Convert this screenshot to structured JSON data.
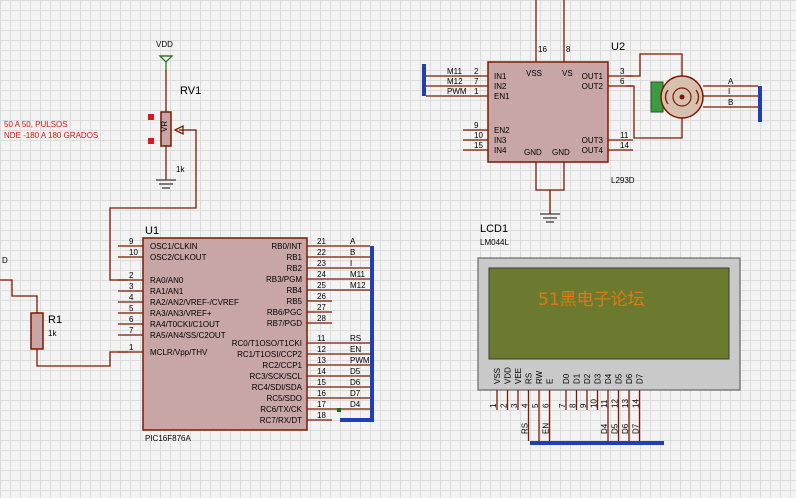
{
  "components": {
    "vdd_label": "VDD",
    "rv1": {
      "ref": "RV1",
      "value": "1k",
      "tag": "VR"
    },
    "note": {
      "line1": "50 A 50, PULSOS",
      "line2": "NDE -180 A 180 GRADOS"
    },
    "r1": {
      "ref": "R1",
      "value": "1k"
    },
    "vdd_clip": "D",
    "u1": {
      "ref": "U1",
      "part": "PIC16F876A",
      "left_pins": [
        {
          "num": "9",
          "name": "OSC1/CLKIN"
        },
        {
          "num": "10",
          "name": "OSC2/CLKOUT"
        },
        {
          "num": "2",
          "name": "RA0/AN0"
        },
        {
          "num": "3",
          "name": "RA1/AN1"
        },
        {
          "num": "4",
          "name": "RA2/AN2/VREF-/CVREF"
        },
        {
          "num": "5",
          "name": "RA3/AN3/VREF+"
        },
        {
          "num": "6",
          "name": "RA4/T0CKI/C1OUT"
        },
        {
          "num": "7",
          "name": "RA5/AN4/SS/C2OUT"
        },
        {
          "num": "1",
          "name": "MCLR/Vpp/THV"
        }
      ],
      "right_pins": [
        {
          "num": "21",
          "name": "RB0/INT",
          "net": "A"
        },
        {
          "num": "22",
          "name": "RB1",
          "net": "B"
        },
        {
          "num": "23",
          "name": "RB2",
          "net": "I"
        },
        {
          "num": "24",
          "name": "RB3/PGM",
          "net": "M11"
        },
        {
          "num": "25",
          "name": "RB4",
          "net": "M12"
        },
        {
          "num": "26",
          "name": "RB5",
          "net": ""
        },
        {
          "num": "27",
          "name": "RB6/PGC",
          "net": ""
        },
        {
          "num": "28",
          "name": "RB7/PGD",
          "net": ""
        },
        {
          "num": "11",
          "name": "RC0/T1OSO/T1CKI",
          "net": "RS"
        },
        {
          "num": "12",
          "name": "RC1/T1OSI/CCP2",
          "net": "EN"
        },
        {
          "num": "13",
          "name": "RC2/CCP1",
          "net": "PWM"
        },
        {
          "num": "14",
          "name": "RC3/SCK/SCL",
          "net": "D5"
        },
        {
          "num": "15",
          "name": "RC4/SDI/SDA",
          "net": "D6"
        },
        {
          "num": "16",
          "name": "RC5/SDO",
          "net": "D7"
        },
        {
          "num": "17",
          "name": "RC6/TX/CK",
          "net": "D4"
        },
        {
          "num": "18",
          "name": "RC7/RX/DT",
          "net": ""
        }
      ]
    },
    "u2": {
      "ref": "U2",
      "part": "L293D",
      "top_pins": [
        {
          "num": "16",
          "name": "VSS"
        },
        {
          "num": "8",
          "name": "VS"
        }
      ],
      "left_pins": [
        {
          "num": "2",
          "name": "IN1",
          "net": "M11"
        },
        {
          "num": "7",
          "name": "IN2",
          "net": "M12"
        },
        {
          "num": "1",
          "name": "EN1",
          "net": "PWM"
        },
        {
          "num": "9",
          "name": "EN2",
          "net": ""
        },
        {
          "num": "10",
          "name": "IN3",
          "net": ""
        },
        {
          "num": "15",
          "name": "IN4",
          "net": ""
        }
      ],
      "right_pins": [
        {
          "num": "3",
          "name": "OUT1"
        },
        {
          "num": "6",
          "name": "OUT2"
        },
        {
          "num": "11",
          "name": "OUT3"
        },
        {
          "num": "14",
          "name": "OUT4"
        }
      ],
      "bottom_pins": [
        {
          "name": "GND"
        },
        {
          "name": "GND"
        }
      ]
    },
    "motor": {
      "nets": [
        "A",
        "I",
        "B"
      ]
    },
    "lcd": {
      "ref": "LCD1",
      "part": "LM044L",
      "screen_text": "51黑电子论坛",
      "screen_color": "#e07a10",
      "pins": [
        {
          "num": "1",
          "name": "VSS"
        },
        {
          "num": "2",
          "name": "VDD"
        },
        {
          "num": "3",
          "name": "VEE"
        },
        {
          "num": "4",
          "name": "RS",
          "net": "RS"
        },
        {
          "num": "5",
          "name": "RW",
          "net": ""
        },
        {
          "num": "6",
          "name": "E",
          "net": "EN"
        },
        {
          "num": "7",
          "name": "D0"
        },
        {
          "num": "8",
          "name": "D1"
        },
        {
          "num": "9",
          "name": "D2"
        },
        {
          "num": "10",
          "name": "D3"
        },
        {
          "num": "11",
          "name": "D4",
          "net": "D4"
        },
        {
          "num": "12",
          "name": "D5",
          "net": "D5"
        },
        {
          "num": "13",
          "name": "D6",
          "net": "D6"
        },
        {
          "num": "14",
          "name": "D7",
          "net": "D7"
        }
      ]
    }
  },
  "colors": {
    "wire": "#7a1a00",
    "bus": "#1f3fb5",
    "body": "#c8a6a6",
    "lcd_screen": "#6b7a2e",
    "lcd_bezel": "#c9c9c9"
  }
}
